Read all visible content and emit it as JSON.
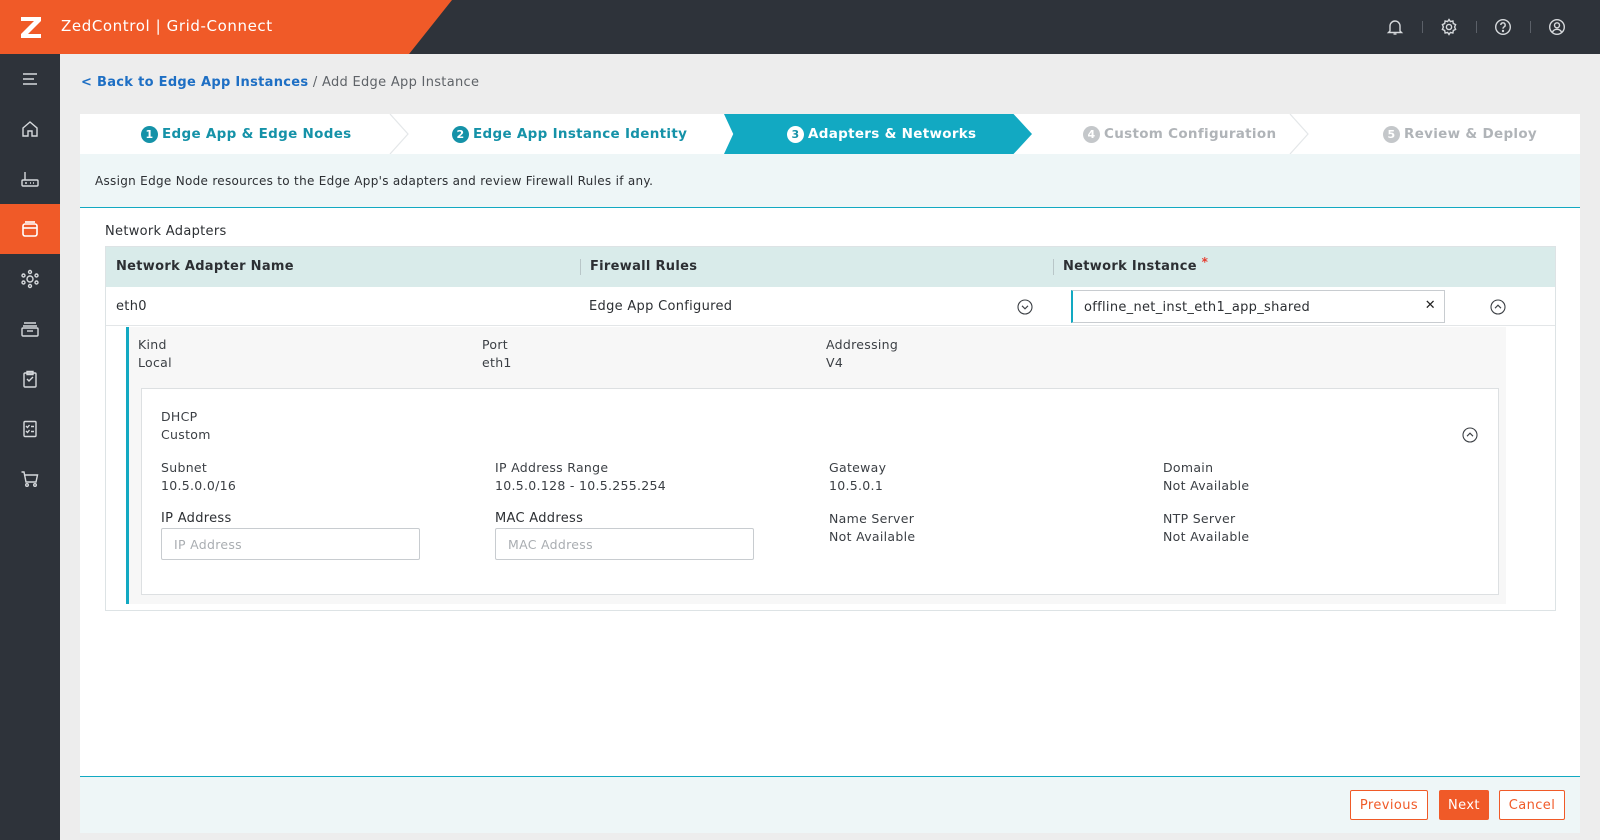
{
  "app": {
    "title": "ZedControl | Grid-Connect",
    "brand_color": "#f05a28",
    "accent_color": "#12a9c2",
    "top_icons": [
      "bell-icon",
      "gear-icon",
      "help-icon",
      "user-icon"
    ]
  },
  "sidebar": {
    "items": [
      {
        "icon": "menu-icon",
        "active": false
      },
      {
        "icon": "home-icon",
        "active": false
      },
      {
        "icon": "edge-node-icon",
        "active": false
      },
      {
        "icon": "edge-app-instances-icon",
        "active": true
      },
      {
        "icon": "network-icon",
        "active": false
      },
      {
        "icon": "storage-icon",
        "active": false
      },
      {
        "icon": "clipboard-icon",
        "active": false
      },
      {
        "icon": "checklist-icon",
        "active": false
      },
      {
        "icon": "marketplace-cart-icon",
        "active": false
      }
    ]
  },
  "breadcrumb": {
    "back_link": "< Back to Edge App Instances",
    "separator": "/",
    "current": "Add Edge App Instance"
  },
  "wizard": {
    "steps": [
      {
        "number": "1",
        "label": "Edge App & Edge Nodes",
        "state": "done"
      },
      {
        "number": "2",
        "label": "Edge App Instance Identity",
        "state": "done"
      },
      {
        "number": "3",
        "label": "Adapters & Networks",
        "state": "current"
      },
      {
        "number": "4",
        "label": "Custom Configuration",
        "state": "future"
      },
      {
        "number": "5",
        "label": "Review & Deploy",
        "state": "future"
      }
    ],
    "description": "Assign Edge Node resources to the Edge App's adapters and review Firewall Rules if any."
  },
  "network_adapters": {
    "section_title": "Network Adapters",
    "columns": {
      "name": "Network Adapter Name",
      "firewall": "Firewall Rules",
      "network_instance": "Network Instance",
      "required_mark": "*"
    },
    "row": {
      "name": "eth0",
      "firewall": "Edge App Configured",
      "network_instance": "offline_net_inst_eth1_app_shared",
      "clear_symbol": "✕"
    },
    "details": {
      "kind_label": "Kind",
      "kind_value": "Local",
      "port_label": "Port",
      "port_value": "eth1",
      "addressing_label": "Addressing",
      "addressing_value": "V4",
      "dhcp_label": "DHCP",
      "dhcp_value": "Custom",
      "subnet_label": "Subnet",
      "subnet_value": "10.5.0.0/16",
      "ip_range_label": "IP Address Range",
      "ip_range_value": "10.5.0.128 - 10.5.255.254",
      "gateway_label": "Gateway",
      "gateway_value": "10.5.0.1",
      "domain_label": "Domain",
      "domain_value": "Not Available",
      "ip_address_label": "IP Address",
      "ip_address_placeholder": "IP Address",
      "ip_address_value": "",
      "mac_address_label": "MAC Address",
      "mac_address_placeholder": "MAC Address",
      "mac_address_value": "",
      "name_server_label": "Name Server",
      "name_server_value": "Not Available",
      "ntp_server_label": "NTP Server",
      "ntp_server_value": "Not Available"
    }
  },
  "footer": {
    "previous": "Previous",
    "next": "Next",
    "cancel": "Cancel"
  }
}
